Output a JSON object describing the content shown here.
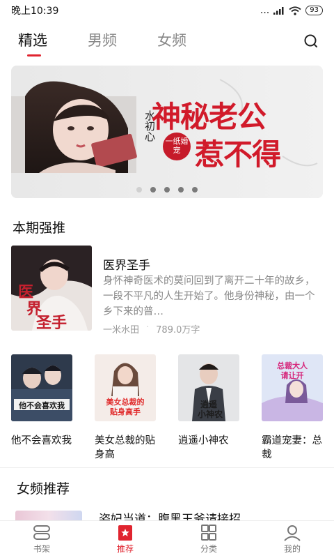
{
  "status_bar": {
    "time": "晚上10:39",
    "signal": "...",
    "battery": "93"
  },
  "tabs": [
    {
      "label": "精选",
      "active": true
    },
    {
      "label": "男频",
      "active": false
    },
    {
      "label": "女频",
      "active": false
    }
  ],
  "banner": {
    "author": "水初心",
    "title_line1": "神秘老公",
    "title_line2": "惹不得",
    "seal": "一纸婚宠",
    "page_count": 5,
    "active_page": 1
  },
  "featured_section": {
    "title": "本期强推",
    "book": {
      "title": "医界圣手",
      "description": "身怀神奇医术的莫问回到了离开二十年的故乡，一段不平凡的人生开始了。他身份神秘，由一个乡下来的普…",
      "author": "一米水田",
      "word_count": "789.0万字",
      "cover_text": "医界圣手",
      "cover_author": "一米水田"
    }
  },
  "book_row": [
    {
      "name": "他不会喜欢我",
      "cover_text": "他不会喜欢我"
    },
    {
      "name": "美女总裁的贴身高",
      "cover_text": "美女总裁的贴身高手"
    },
    {
      "name": "逍遥小神农",
      "cover_text": "逍遥小神农"
    },
    {
      "name": "霸道宠妻：总裁",
      "cover_text": "总裁大人请让开"
    }
  ],
  "female_section": {
    "title": "女频推荐",
    "peek_title": "姿妃当道：腹黑王爷请接招"
  },
  "bottom_nav": [
    {
      "label": "书架",
      "icon": "bookshelf-icon",
      "active": false
    },
    {
      "label": "推荐",
      "icon": "star-bookmark-icon",
      "active": true
    },
    {
      "label": "分类",
      "icon": "grid-icon",
      "active": false
    },
    {
      "label": "我的",
      "icon": "user-icon",
      "active": false
    }
  ],
  "colors": {
    "accent": "#e0242f",
    "banner_title": "#d11a2a"
  }
}
